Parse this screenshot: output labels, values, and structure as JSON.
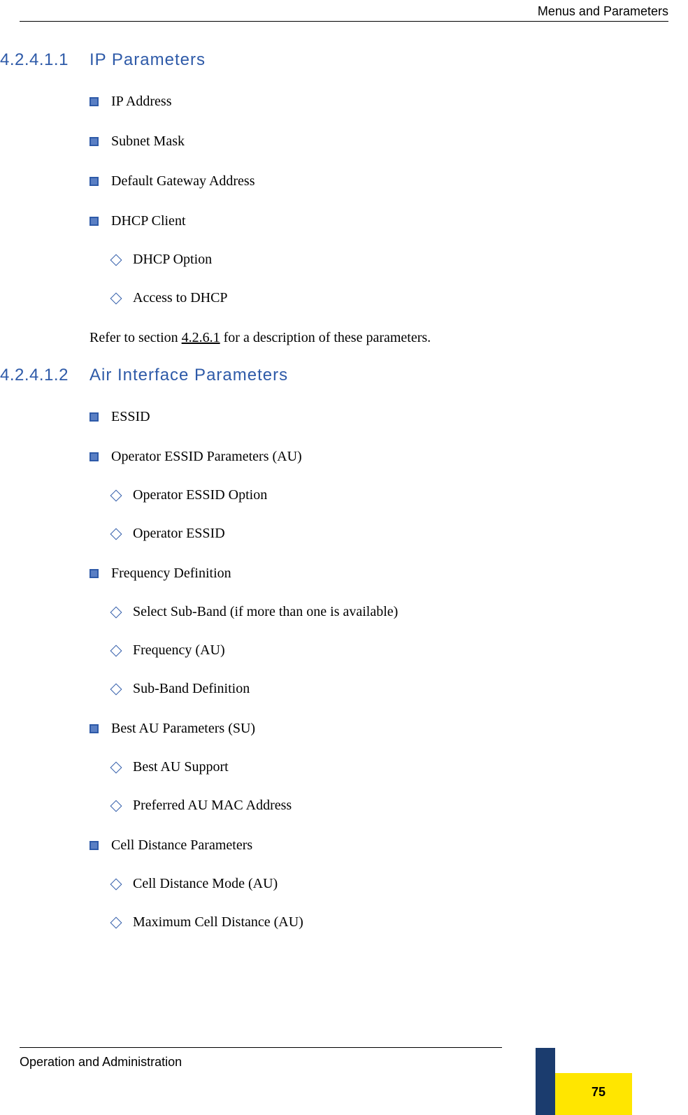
{
  "header": {
    "right_text": "Menus and Parameters"
  },
  "section1": {
    "number": "4.2.4.1.1",
    "title": "IP Parameters",
    "items": [
      "IP Address",
      "Subnet Mask",
      "Default Gateway Address",
      "DHCP Client"
    ],
    "sub_items": [
      "DHCP Option",
      "Access to DHCP"
    ],
    "para_pre": "Refer to section ",
    "para_link": "4.2.6.1",
    "para_post": " for a description of these parameters."
  },
  "section2": {
    "number": "4.2.4.1.2",
    "title": "Air Interface Parameters",
    "groups": [
      {
        "label": "ESSID",
        "subs": []
      },
      {
        "label": "Operator ESSID Parameters (AU)",
        "subs": [
          "Operator ESSID Option",
          "Operator ESSID"
        ]
      },
      {
        "label": "Frequency Definition",
        "subs": [
          "Select Sub-Band (if more than one is available)",
          "Frequency (AU)",
          "Sub-Band Definition"
        ]
      },
      {
        "label": "Best AU Parameters (SU)",
        "subs": [
          "Best AU Support",
          "Preferred AU MAC Address"
        ]
      },
      {
        "label": "Cell Distance Parameters",
        "subs": [
          "Cell Distance Mode (AU)",
          "Maximum Cell Distance (AU)"
        ]
      }
    ]
  },
  "footer": {
    "left_text": "Operation and Administration",
    "page_number": "75"
  }
}
